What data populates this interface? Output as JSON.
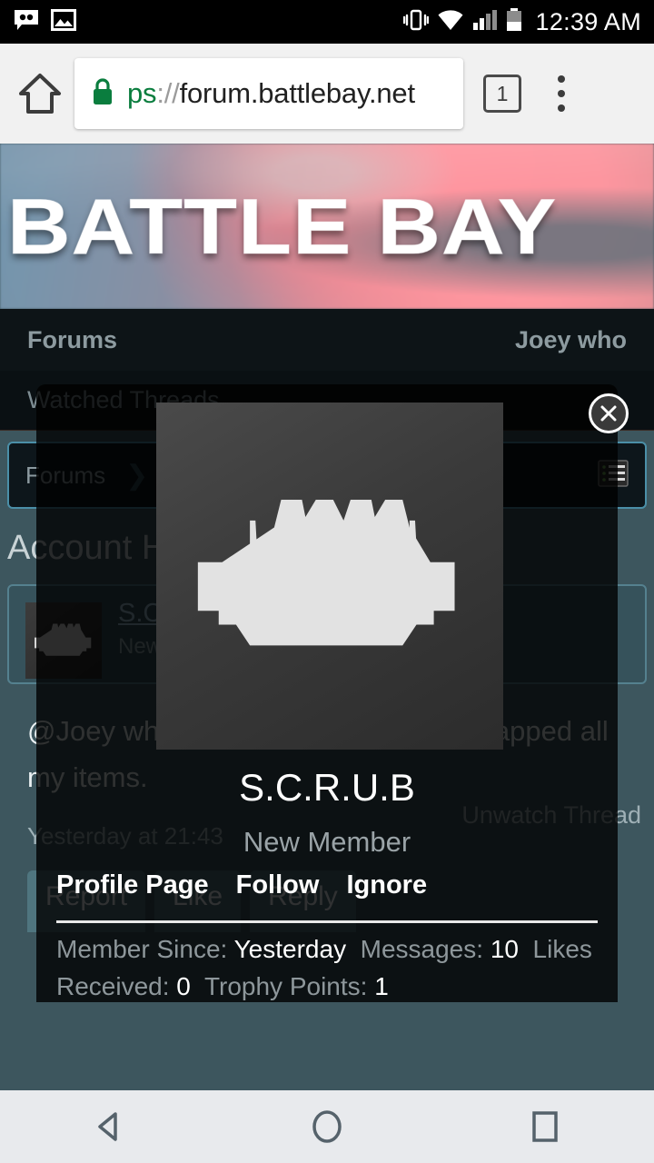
{
  "status_bar": {
    "icons": [
      "voicemail-icon",
      "image-icon",
      "vibrate-icon",
      "wifi-icon",
      "signal-icon",
      "battery-icon"
    ],
    "time": "12:39 AM"
  },
  "browser": {
    "home_icon": "home-icon",
    "lock_icon": "lock-icon",
    "url_scheme": "ps",
    "url_separator": "://",
    "url_host": "forum.battlebay.net",
    "tab_count": "1",
    "menu_icon": "kebab-menu-icon"
  },
  "site": {
    "logo_text": "BATTLE BAY",
    "nav_left": "Forums",
    "nav_user": "Joey who",
    "watched": "Watched Threads",
    "breadcrumb_root": "Forums",
    "breadcrumb_chevron": "❯",
    "breadcrumb_icon": "list-view-icon",
    "thread_title": "Account Hacked",
    "unwatch_link": "Unwatch Thread"
  },
  "post": {
    "author": "S.C.R.U.B",
    "author_role": "New Member",
    "avatar_icon": "ship-avatar-icon",
    "body": "@Joey who stole my account and scrapped all my items.",
    "timestamp": "Yesterday at 21:43",
    "actions": [
      "Report",
      "Like",
      "Reply"
    ]
  },
  "modal": {
    "close_icon": "close-icon",
    "avatar_icon": "ship-avatar-icon",
    "username": "S.C.R.U.B",
    "user_title": "New Member",
    "links": [
      "Profile Page",
      "Follow",
      "Ignore"
    ],
    "stats": [
      {
        "label": "Member Since:",
        "value": "Yesterday"
      },
      {
        "label": "Messages:",
        "value": "10"
      },
      {
        "label": "Likes Received:",
        "value": "0"
      },
      {
        "label": "Trophy Points:",
        "value": "1"
      }
    ]
  },
  "android_nav": {
    "back": "back-icon",
    "home": "home-circle-icon",
    "recents": "recents-icon"
  },
  "colors": {
    "page_bg": "#3d565e",
    "accent": "#4b8fa8",
    "button": "#4f757f",
    "modal_bg": "rgba(0,0,0,.80)",
    "lock_green": "#0a7d3e"
  }
}
